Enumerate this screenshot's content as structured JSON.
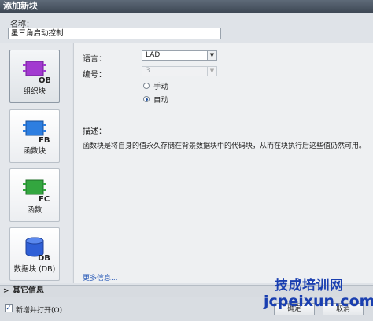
{
  "dialog": {
    "title": "添加新块"
  },
  "name_field": {
    "label": "名称：",
    "value": "星三角启动控制"
  },
  "block_types": [
    {
      "label": "组织块",
      "code": "OB",
      "color": "#9b30c9",
      "icon": "ob-block-icon"
    },
    {
      "label": "函数块",
      "code": "FB",
      "color": "#1f6fd1",
      "icon": "fb-block-icon"
    },
    {
      "label": "函数",
      "code": "FC",
      "color": "#2e9e3a",
      "icon": "fc-block-icon"
    },
    {
      "label": "数据块 (DB)",
      "code": "DB",
      "color": "#2a5ad8",
      "icon": "db-block-icon"
    }
  ],
  "settings": {
    "language_label": "语言：",
    "language_value": "LAD",
    "number_label": "编号：",
    "number_value": "3",
    "radio_manual": "手动",
    "radio_auto": "自动",
    "selected_mode": "自动"
  },
  "description": {
    "title": "描述：",
    "text": "函数块是将自身的值永久存储在背景数据块中的代码块，从而在块执行后这些值仍然可用。"
  },
  "more_info_link": "更多信息...",
  "other_info": {
    "label": "其它信息"
  },
  "footer": {
    "add_and_open_label": "新增并打开(O)",
    "add_and_open_checked": true,
    "ok_label": "确定",
    "cancel_label": "取消"
  },
  "watermark": {
    "line1": "技成培训网",
    "line2": "jcpeixun.com"
  }
}
